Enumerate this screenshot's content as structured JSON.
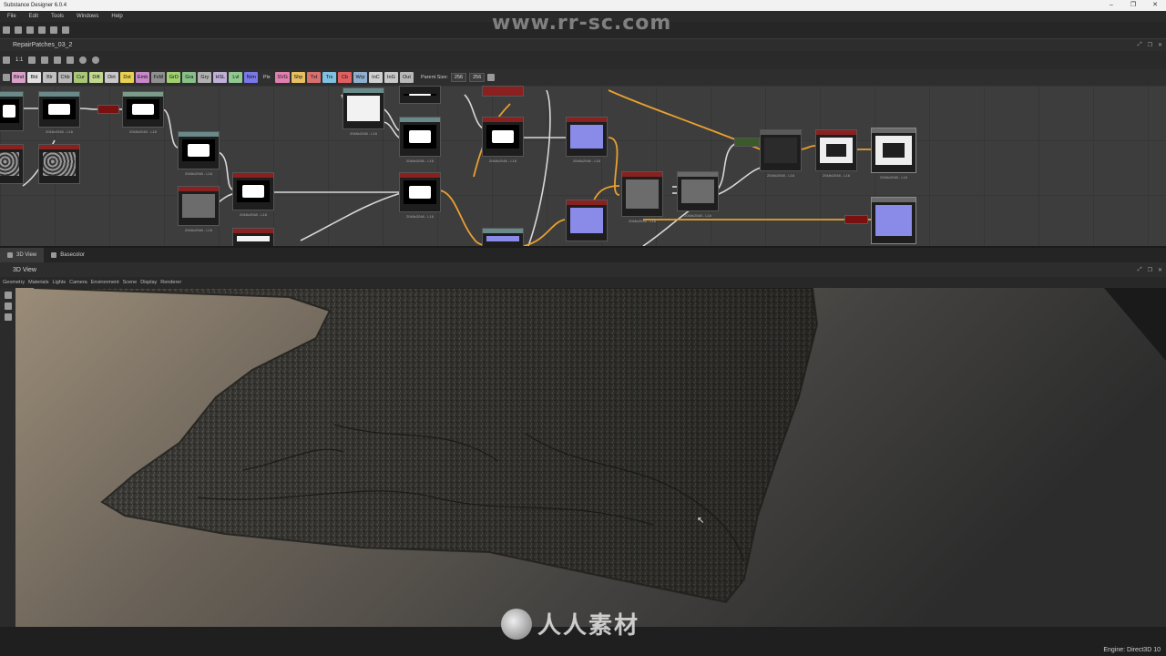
{
  "window": {
    "title": "Substance Designer 6.0.4",
    "controls": [
      "–",
      "❐",
      "✕"
    ]
  },
  "menu": [
    "File",
    "Edit",
    "Tools",
    "Windows",
    "Help"
  ],
  "watermark_top": "www.rr-sc.com",
  "graph": {
    "title": "RepairPatches_03_2",
    "zoom_label": "1:1",
    "parent_size_label": "Parent Size:",
    "parent_size_w": "256",
    "parent_size_h": "256",
    "atoms": [
      {
        "label": "Blnd",
        "color": "#d9a0c8"
      },
      {
        "label": "Bld",
        "color": "#e0e0e0"
      },
      {
        "label": "Blr",
        "color": "#c0c0c0"
      },
      {
        "label": "Chb",
        "color": "#b8b8b8"
      },
      {
        "label": "Cur",
        "color": "#a8c878"
      },
      {
        "label": "Dift",
        "color": "#c0d890"
      },
      {
        "label": "Dirt",
        "color": "#c8c8c8"
      },
      {
        "label": "Dst",
        "color": "#e8d050"
      },
      {
        "label": "Emb",
        "color": "#c888c8"
      },
      {
        "label": "FxM",
        "color": "#909090"
      },
      {
        "label": "GrD",
        "color": "#a0d070"
      },
      {
        "label": "Gra",
        "color": "#88c088"
      },
      {
        "label": "Gry",
        "color": "#b0b0b0"
      },
      {
        "label": "HSL",
        "color": "#c0b0d8"
      },
      {
        "label": "Lvl",
        "color": "#90c890"
      },
      {
        "label": "Nrm",
        "color": "#7878e8"
      },
      {
        "label": "Pix",
        "color": "#303030"
      },
      {
        "label": "SVG",
        "color": "#e080b0"
      },
      {
        "label": "Shp",
        "color": "#e8c060"
      },
      {
        "label": "Txt",
        "color": "#d87070"
      },
      {
        "label": "Trs",
        "color": "#80c0e0"
      },
      {
        "label": "Cb",
        "color": "#e06060"
      },
      {
        "label": "Wrp",
        "color": "#90b0d0"
      },
      {
        "label": "InC",
        "color": "#d0d0d0"
      },
      {
        "label": "InG",
        "color": "#c8c8c8"
      },
      {
        "label": "Out",
        "color": "#b8b8b8"
      }
    ],
    "node_caption": "2048x2048 - L16"
  },
  "lower_tabs": [
    {
      "label": "3D View",
      "active": true
    },
    {
      "label": "Basecolor",
      "active": false
    }
  ],
  "view": {
    "title": "3D View",
    "menu": [
      "Geometry",
      "Materials",
      "Lights",
      "Camera",
      "Environment",
      "Scene",
      "Display",
      "Renderer"
    ]
  },
  "status": {
    "engine": "Engine: Direct3D 10"
  },
  "watermark_bottom": "人人素材"
}
